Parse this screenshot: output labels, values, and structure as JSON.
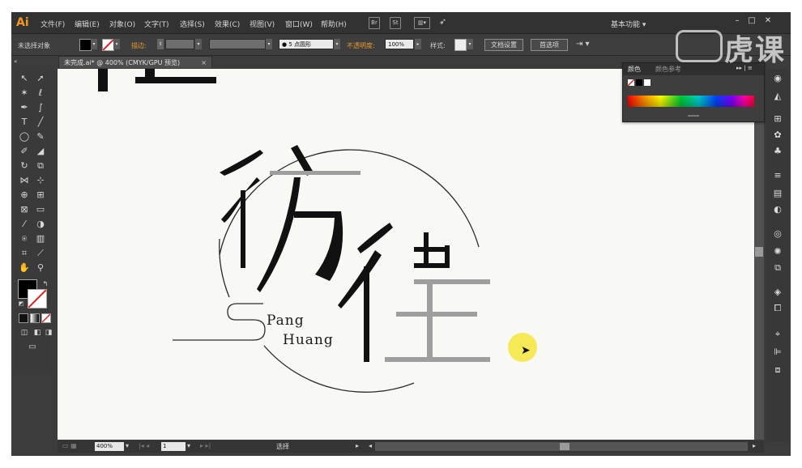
{
  "app": {
    "logo": "Ai",
    "menu": [
      "文件(F)",
      "编辑(E)",
      "对象(O)",
      "文字(T)",
      "选择(S)",
      "效果(C)",
      "视图(V)",
      "窗口(W)",
      "帮助(H)"
    ],
    "bridge_button": "Br",
    "stock_button": "St",
    "workspace": "基本功能",
    "workspace_caret": "▾",
    "search_placeholder": "",
    "minimize": "–",
    "maximize": "□",
    "close": "✕"
  },
  "control_bar": {
    "selection_label": "未选择对象",
    "stroke_label": "描边:",
    "brush_value": "5 点圆形",
    "opacity_label": "不透明度:",
    "opacity_value": "100%",
    "style_label": "样式:",
    "document_setup": "文档设置",
    "preferences": "首选项"
  },
  "document": {
    "tab_title": "未完成.ai* @ 400% (CMYK/GPU 预览)",
    "tab_close": "×"
  },
  "artwork": {
    "line1_char1": "彷",
    "line2_char": "徨",
    "latin_line1": "Pang",
    "latin_line2": "Huang"
  },
  "color_panel": {
    "tab_color": "颜色",
    "tab_color_guide": "颜色参考",
    "menu_glyph": "▸▸ | ≡"
  },
  "status_bar": {
    "zoom": "400%",
    "artboard": "1",
    "mode": "选择"
  },
  "watermark": {
    "text": "虎课"
  },
  "icons": {
    "tools": [
      "selection-arrow",
      "direct-select",
      "magic-wand",
      "lasso",
      "pen",
      "curvature",
      "type",
      "line",
      "ellipse",
      "paintbrush",
      "pencil",
      "eraser",
      "rotate",
      "scale",
      "width",
      "free-transform",
      "shape-builder",
      "perspective",
      "mesh",
      "gradient",
      "eyedropper",
      "blend",
      "symbol-sprayer",
      "column-graph",
      "artboard",
      "slice",
      "hand",
      "zoom"
    ],
    "dock": [
      "color",
      "color-guide",
      "swatches",
      "brushes",
      "symbols",
      "stroke",
      "gradient",
      "transparency",
      "appearance",
      "graphic-styles",
      "layers",
      "artboards",
      "align",
      "pathfinder",
      "transform"
    ]
  },
  "colors": {
    "accent": "#f39a1e",
    "cursor_highlight": "#f6e84e",
    "artwork_gray": "#9e9e9e"
  }
}
